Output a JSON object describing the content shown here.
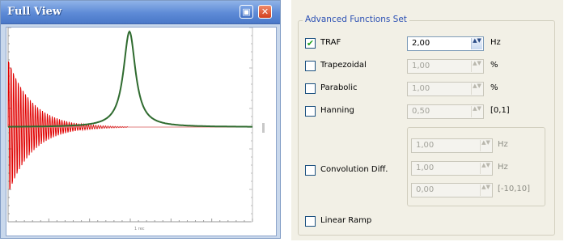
{
  "full_view": {
    "title": "Full View",
    "restore_glyph": "▣",
    "close_glyph": "✕",
    "axis_tiny_label": "1 rec",
    "colors": {
      "fid": "#e00000",
      "lorentzian": "#2f6b2f",
      "baseline": "#e08080"
    }
  },
  "afs": {
    "legend": "Advanced Functions Set",
    "rows": [
      {
        "label": "TRAF",
        "checked": true,
        "value": "2,00",
        "unit": "Hz"
      },
      {
        "label": "Trapezoidal",
        "checked": false,
        "value": "1,00",
        "unit": "%"
      },
      {
        "label": "Parabolic",
        "checked": false,
        "value": "1,00",
        "unit": "%"
      },
      {
        "label": "Hanning",
        "checked": false,
        "value": "0,50",
        "unit": "[0,1]"
      }
    ],
    "convolution": {
      "label": "Convolution Diff.",
      "checked": false,
      "fields": [
        {
          "value": "1,00",
          "unit": "Hz"
        },
        {
          "value": "1,00",
          "unit": "Hz"
        },
        {
          "value": "0,00",
          "unit": "[-10,10]"
        }
      ]
    },
    "linear_ramp": {
      "label": "Linear Ramp",
      "checked": false
    },
    "check_glyph": "✔",
    "spin_glyph": "▲▼"
  }
}
